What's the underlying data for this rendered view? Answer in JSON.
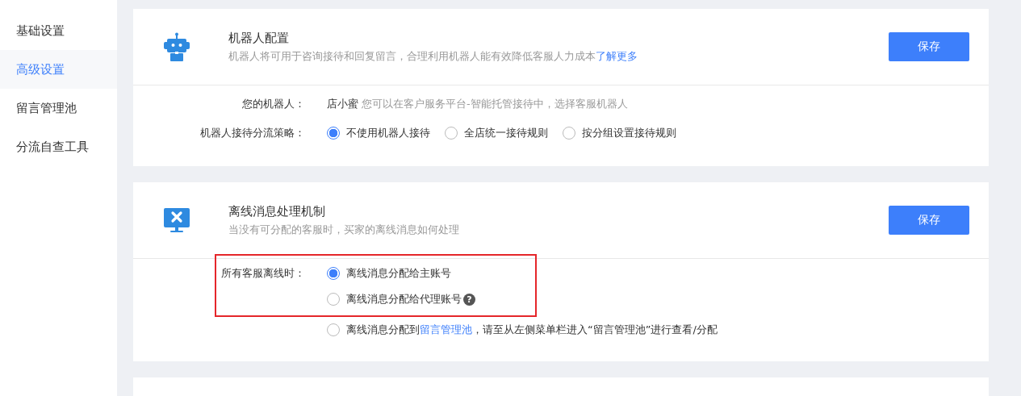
{
  "sidebar": {
    "items": [
      {
        "label": "基础设置",
        "selected": false
      },
      {
        "label": "高级设置",
        "selected": true
      },
      {
        "label": "留言管理池",
        "selected": false
      },
      {
        "label": "分流自查工具",
        "selected": false
      }
    ]
  },
  "cards": [
    {
      "kind": "robot",
      "title": "机器人配置",
      "description": "机器人将可用于咨询接待和回复留言，合理利用机器人能有效降低客服人力成本",
      "link": "了解更多",
      "button": "保存",
      "fields": [
        {
          "kind": "info",
          "label": "您的机器人：",
          "value": "店小蜜",
          "hint": "您可以在客户服务平台-智能托管接待中，选择客服机器人"
        },
        {
          "kind": "radios",
          "label": "机器人接待分流策略：",
          "options": [
            {
              "text": "不使用机器人接待",
              "selected": true
            },
            {
              "text": "全店统一接待规则",
              "selected": false
            },
            {
              "text": "按分组设置接待规则",
              "selected": false
            }
          ]
        }
      ]
    },
    {
      "kind": "offline",
      "title": "离线消息处理机制",
      "description": "当没有可分配的客服时，买家的离线消息如何处理",
      "button": "保存",
      "fields": [
        {
          "kind": "stack",
          "label": "所有客服离线时：",
          "options": [
            {
              "text": "离线消息分配给主账号",
              "selected": true,
              "highlighted": true
            },
            {
              "text": "离线消息分配给代理账号",
              "selected": false,
              "highlighted": true,
              "help": "?"
            },
            {
              "text": "离线消息分配到",
              "link": "留言管理池",
              "after": "，请至从左侧菜单栏进入“留言管理池”进行查看/分配",
              "selected": false,
              "highlighted": false
            }
          ]
        }
      ]
    }
  ]
}
